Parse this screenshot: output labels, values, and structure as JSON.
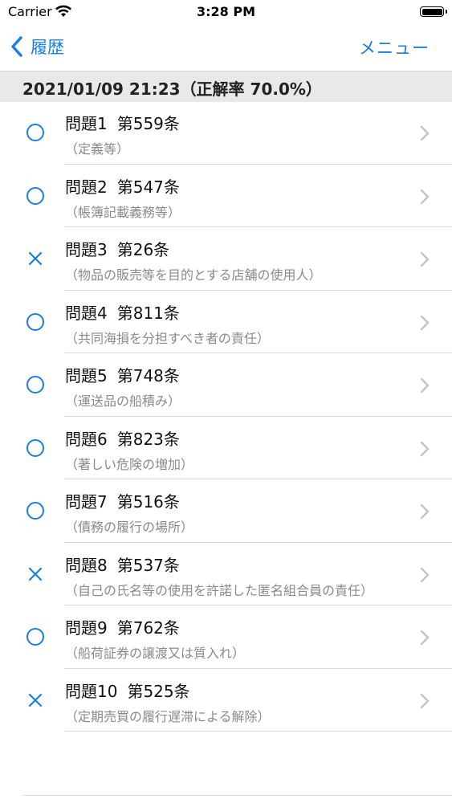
{
  "status_bar": {
    "carrier": "Carrier",
    "time": "3:28 PM"
  },
  "nav": {
    "back_label": "履歴",
    "menu_label": "メニュー"
  },
  "section": {
    "header": "2021/01/09 21:23（正解率 70.0%）"
  },
  "colors": {
    "accent": "#1a7fe0",
    "section_bg": "#e9e9eb",
    "subtitle": "#8a8a8e"
  },
  "items": [
    {
      "title": "問題1",
      "article": "第559条",
      "subtitle": "（定義等）",
      "result": "correct"
    },
    {
      "title": "問題2",
      "article": "第547条",
      "subtitle": "（帳簿記載義務等）",
      "result": "correct"
    },
    {
      "title": "問題3",
      "article": "第26条",
      "subtitle": "（物品の販売等を目的とする店舗の使用人）",
      "result": "incorrect"
    },
    {
      "title": "問題4",
      "article": "第811条",
      "subtitle": "（共同海損を分担すべき者の責任）",
      "result": "correct"
    },
    {
      "title": "問題5",
      "article": "第748条",
      "subtitle": "（運送品の船積み）",
      "result": "correct"
    },
    {
      "title": "問題6",
      "article": "第823条",
      "subtitle": "（著しい危険の増加）",
      "result": "correct"
    },
    {
      "title": "問題7",
      "article": "第516条",
      "subtitle": "（債務の履行の場所）",
      "result": "correct"
    },
    {
      "title": "問題8",
      "article": "第537条",
      "subtitle": "（自己の氏名等の使用を許諾した匿名組合員の責任）",
      "result": "incorrect"
    },
    {
      "title": "問題9",
      "article": "第762条",
      "subtitle": "（船荷証券の譲渡又は質入れ）",
      "result": "correct"
    },
    {
      "title": "問題10",
      "article": "第525条",
      "subtitle": "（定期売買の履行遅滞による解除）",
      "result": "incorrect"
    }
  ]
}
